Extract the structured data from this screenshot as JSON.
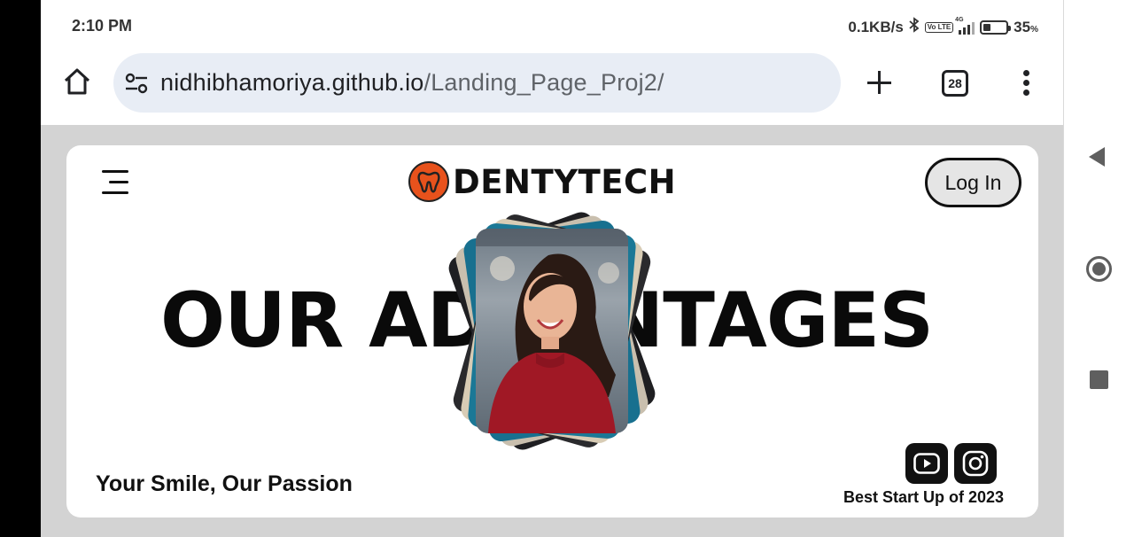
{
  "status_bar": {
    "time": "2:10 PM",
    "net_speed": "0.1KB/s",
    "volte": "Vo LTE",
    "network": "4G",
    "battery_level": 0.35,
    "battery_text": "35",
    "battery_unit": "%"
  },
  "browser": {
    "url_host": "nidhibhamoriya.github.io",
    "url_path": "/Landing_Page_Proj2/",
    "tab_count": "28"
  },
  "page": {
    "brand": "DENTYTECH",
    "login_label": "Log In",
    "headline": "OUR ADVANTAGES",
    "tagline": "Your Smile, Our Passion",
    "award": "Best Start Up of 2023",
    "accent_color": "#e8521c",
    "social_icons": [
      "youtube-icon",
      "instagram-icon"
    ]
  }
}
